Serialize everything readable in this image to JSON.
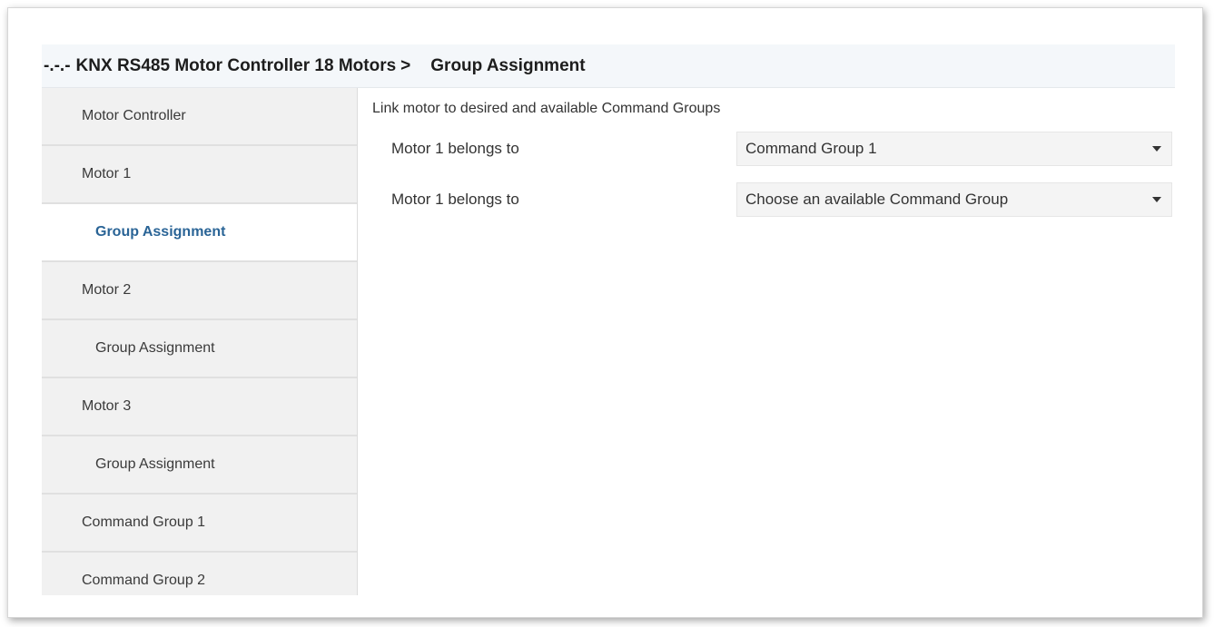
{
  "header": {
    "root": "-.-.-",
    "device": "KNX RS485 Motor Controller 18 Motors",
    "separator": ">",
    "current": "Group Assignment"
  },
  "sidebar": {
    "items": [
      {
        "label": "Motor Controller"
      },
      {
        "label": "Motor 1"
      },
      {
        "label": "Group Assignment"
      },
      {
        "label": "Motor 2"
      },
      {
        "label": "Group Assignment"
      },
      {
        "label": "Motor 3"
      },
      {
        "label": "Group Assignment"
      },
      {
        "label": "Command Group 1"
      },
      {
        "label": "Command Group 2"
      }
    ],
    "active_index": 2
  },
  "main": {
    "section_title": "Link motor to desired and available Command Groups",
    "params": [
      {
        "label": "Motor 1 belongs to",
        "value": "Command Group 1"
      },
      {
        "label": "Motor 1 belongs to",
        "value": "Choose an available Command Group"
      }
    ]
  },
  "colors": {
    "header_bg": "#f4f7fa",
    "sidebar_bg": "#f1f1f1",
    "active_text": "#2a6496",
    "select_bg": "#f4f4f4"
  },
  "icons": {
    "dropdown": "chevron-down-icon"
  }
}
